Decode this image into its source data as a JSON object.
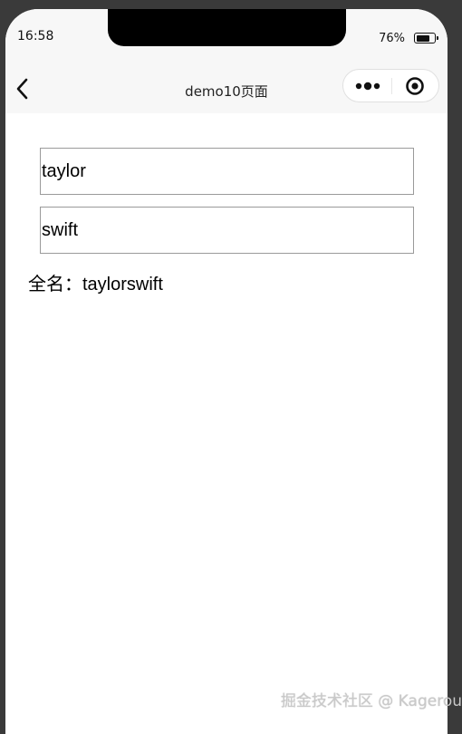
{
  "status_bar": {
    "time": "16:58",
    "battery_percent": "76%",
    "battery_level": 0.76
  },
  "nav": {
    "title": "demo10页面",
    "back_icon": "chevron-left-icon",
    "more_icon": "more-dots-icon",
    "close_icon": "target-circle-icon"
  },
  "form": {
    "first_name_value": "taylor",
    "last_name_value": "swift"
  },
  "fullname": {
    "label": "全名：",
    "value": "taylorswift"
  },
  "watermark": "掘金技术社区 @ Kagerou",
  "colors": {
    "background_outer": "#3a3a3a",
    "nav_background": "#f7f7f7",
    "input_border": "#9a9a9a"
  }
}
